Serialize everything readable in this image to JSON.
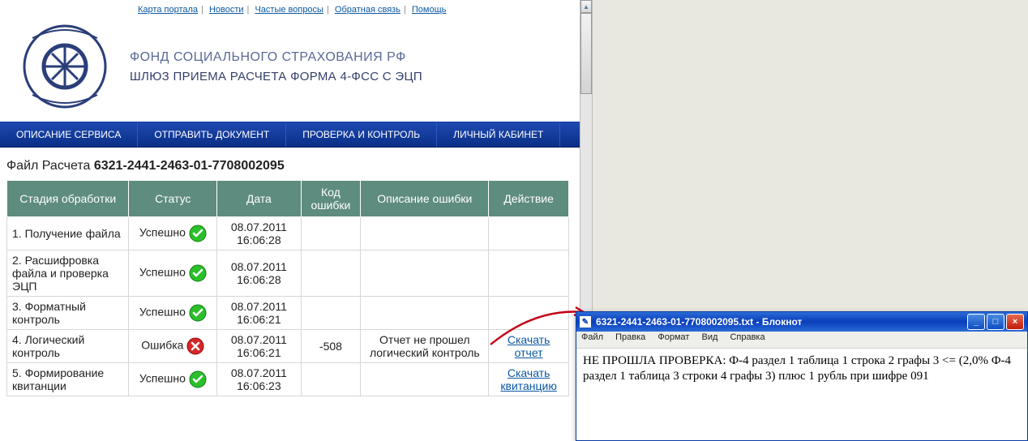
{
  "top_nav": {
    "l1": "Карта портала",
    "l2": "Новости",
    "l3": "Частые вопросы",
    "l4": "Обратная связь",
    "l5": "Помощь"
  },
  "header": {
    "org": "ФОНД СОЦИАЛЬНОГО СТРАХОВАНИЯ РФ",
    "sub": "ШЛЮЗ ПРИЕМА РАСЧЕТА ФОРМА 4-ФСС С ЭЦП"
  },
  "menu": {
    "m1": "ОПИСАНИЕ СЕРВИСА",
    "m2": "ОТПРАВИТЬ ДОКУМЕНТ",
    "m3": "ПРОВЕРКА И КОНТРОЛЬ",
    "m4": "ЛИЧНЫЙ КАБИНЕТ"
  },
  "file": {
    "label": "Файл Расчета",
    "number": "6321-2441-2463-01-7708002095"
  },
  "cols": {
    "c1": "Стадия обработки",
    "c2": "Статус",
    "c3": "Дата",
    "c4": "Код ошибки",
    "c5": "Описание ошибки",
    "c6": "Действие"
  },
  "rows": [
    {
      "stage": "1. Получение файла",
      "status": "Успешно",
      "ok": true,
      "date": "08.07.2011 16:06:28",
      "code": "",
      "desc": "",
      "action": ""
    },
    {
      "stage": "2. Расшифровка файла и проверка ЭЦП",
      "status": "Успешно",
      "ok": true,
      "date": "08.07.2011 16:06:28",
      "code": "",
      "desc": "",
      "action": ""
    },
    {
      "stage": "3. Форматный контроль",
      "status": "Успешно",
      "ok": true,
      "date": "08.07.2011 16:06:21",
      "code": "",
      "desc": "",
      "action": ""
    },
    {
      "stage": "4. Логический контроль",
      "status": "Ошибка",
      "ok": false,
      "date": "08.07.2011 16:06:21",
      "code": "-508",
      "desc": "Отчет не прошел логический контроль",
      "action": "Скачать отчет"
    },
    {
      "stage": "5. Формирование квитанции",
      "status": "Успешно",
      "ok": true,
      "date": "08.07.2011 16:06:23",
      "code": "",
      "desc": "",
      "action": "Скачать квитанцию"
    }
  ],
  "notepad": {
    "title": "6321-2441-2463-01-7708002095.txt - Блокнот",
    "menu": {
      "m1": "Файл",
      "m2": "Правка",
      "m3": "Формат",
      "m4": "Вид",
      "m5": "Справка"
    },
    "body": "НЕ ПРОШЛА ПРОВЕРКА: Ф-4 раздел 1 таблица 1 строка 2 графы 3 <= (2,0% Ф-4 раздел 1 таблица 3 строки 4 графы 3) плюс 1 рубль при шифре 091"
  }
}
